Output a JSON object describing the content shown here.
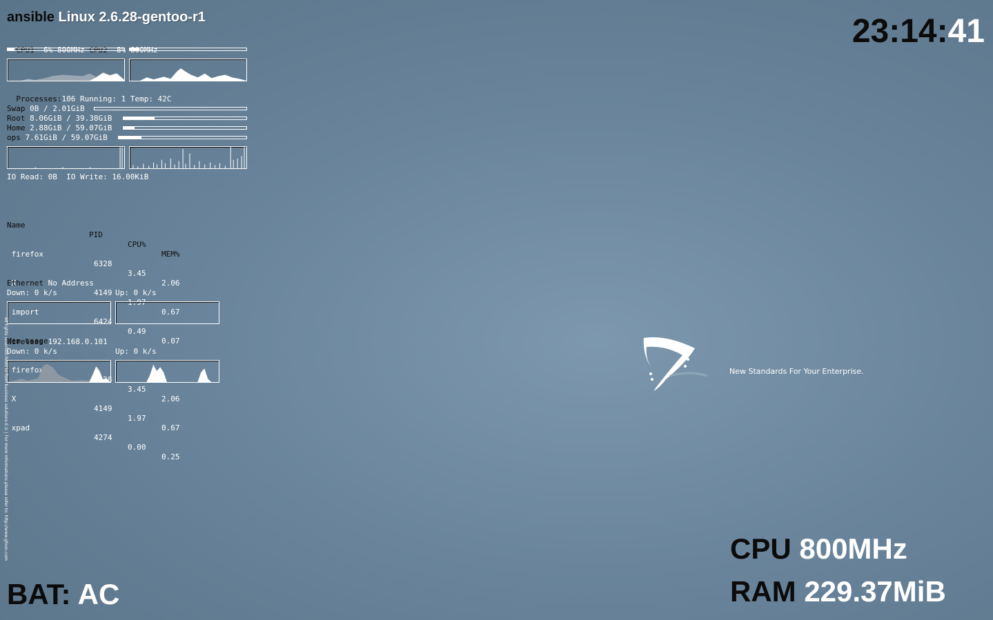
{
  "header": {
    "hostname": "ansible",
    "kernel": "Linux 2.6.28-gentoo-r1"
  },
  "clock": {
    "hm": "23:14:",
    "sec": "41"
  },
  "cpu": {
    "cpu1_label": "CPU1",
    "cpu1_value": "  6% 800MHz",
    "cpu2_label": "CPU2",
    "cpu2_value": "  8% 800MHz",
    "cpu1_usage": 0.06,
    "cpu2_usage": 0.08
  },
  "processes": {
    "label": "Processes:",
    "value": "106 Running: 1 Temp: 42C"
  },
  "storage": [
    {
      "label": "Swap",
      "value": " 0B / 2.01GiB",
      "usage": 0.0
    },
    {
      "label": "Root",
      "value": " 8.06GiB / 39.38GiB",
      "usage": 0.25
    },
    {
      "label": "Home",
      "value": " 2.88GiB / 59.07GiB",
      "usage": 0.09
    },
    {
      "label": "ops",
      "value": " 7.61GiB / 59.07GiB",
      "usage": 0.18
    }
  ],
  "io": {
    "text": "IO Read: 0B  IO Write: 16.00KiB"
  },
  "top_cpu": {
    "headers": {
      "name": "Name",
      "pid": "PID",
      "cpu": "CPU%",
      "mem": "MEM%"
    },
    "rows": [
      {
        "name": " firefox",
        "pid": "6328",
        "cpu": "3.45",
        "mem": "2.06"
      },
      {
        "name": " X",
        "pid": "4149",
        "cpu": "1.97",
        "mem": "0.67"
      },
      {
        "name": " import",
        "pid": "6424",
        "cpu": "0.49",
        "mem": "0.07"
      }
    ]
  },
  "top_mem": {
    "title": "Mem usage",
    "rows": [
      {
        "name": " firefox",
        "pid": "6328",
        "cpu": "3.45",
        "mem": "2.06"
      },
      {
        "name": " X",
        "pid": "4149",
        "cpu": "1.97",
        "mem": "0.67"
      },
      {
        "name": " xpad",
        "pid": "4274",
        "cpu": "0.00",
        "mem": "0.25"
      }
    ]
  },
  "ethernet": {
    "label": "Ethernet",
    "address": " No Address",
    "down": "Down: 0 k/s",
    "up": "Up: 0 k/s"
  },
  "wireless": {
    "label": "Wireless",
    "address": " 192.168.0.101",
    "down": "Down: 0 k/s",
    "up": "Up: 0 k/s"
  },
  "side_text": "All rights reserved Rodd to foon business solutions E.V.  |  For more informations please refer to: http://www.gfoon.com",
  "bottom": {
    "bat_label": "BAT:",
    "bat_value": "AC",
    "cpu_label": "CPU",
    "cpu_value": "800MHz",
    "ram_label": "RAM",
    "ram_value": "229.37MiB"
  },
  "wallpaper": {
    "tagline": "New Standards For Your Enterprise."
  },
  "colors": {
    "background": "#6a859c",
    "dark_text": "#0b0b0b",
    "light_text": "#ffffff"
  }
}
